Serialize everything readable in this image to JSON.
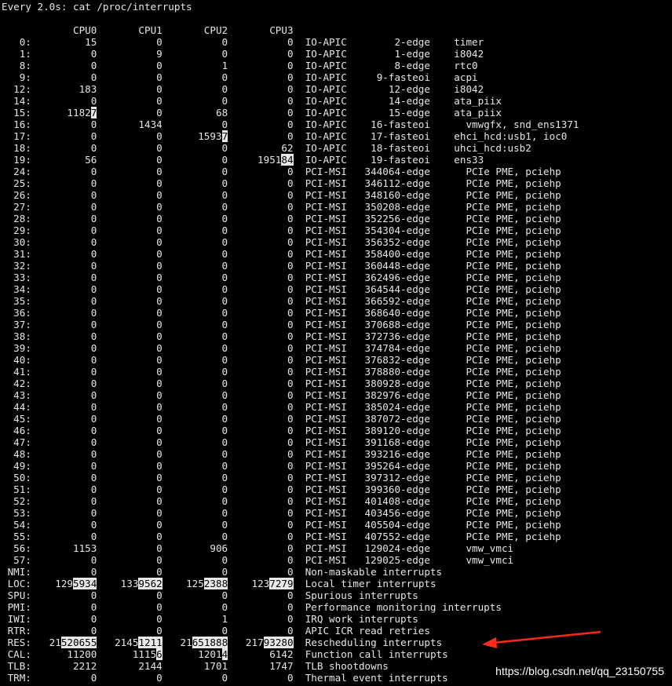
{
  "terminal": {
    "header": "Every 2.0s: cat /proc/interrupts",
    "cpu_header": [
      "CPU0",
      "CPU1",
      "CPU2",
      "CPU3"
    ],
    "rows": [
      {
        "irq": "0:",
        "c": [
          "15",
          "0",
          "0",
          "0"
        ],
        "chip": "IO-APIC",
        "hw": "2-edge",
        "dev": "timer"
      },
      {
        "irq": "1:",
        "c": [
          "0",
          "9",
          "0",
          "0"
        ],
        "chip": "IO-APIC",
        "hw": "1-edge",
        "dev": "i8042"
      },
      {
        "irq": "8:",
        "c": [
          "0",
          "0",
          "1",
          "0"
        ],
        "chip": "IO-APIC",
        "hw": "8-edge",
        "dev": "rtc0"
      },
      {
        "irq": "9:",
        "c": [
          "0",
          "0",
          "0",
          "0"
        ],
        "chip": "IO-APIC",
        "hw": "9-fasteoi",
        "dev": "acpi"
      },
      {
        "irq": "12:",
        "c": [
          "183",
          "0",
          "0",
          "0"
        ],
        "chip": "IO-APIC",
        "hw": "12-edge",
        "dev": "i8042"
      },
      {
        "irq": "14:",
        "c": [
          "0",
          "0",
          "0",
          "0"
        ],
        "chip": "IO-APIC",
        "hw": "14-edge",
        "dev": "ata_piix"
      },
      {
        "irq": "15:",
        "c": [
          "11827",
          "0",
          "68",
          "0"
        ],
        "chip": "IO-APIC",
        "hw": "15-edge",
        "dev": "ata_piix",
        "hl": [
          [
            0,
            1
          ]
        ]
      },
      {
        "irq": "16:",
        "c": [
          "0",
          "1434",
          "0",
          "0"
        ],
        "chip": "IO-APIC",
        "hw": "16-fasteoi",
        "dev": "vmwgfx, snd_ens1371"
      },
      {
        "irq": "17:",
        "c": [
          "0",
          "0",
          "15937",
          "0"
        ],
        "chip": "IO-APIC",
        "hw": "17-fasteoi",
        "dev": "ehci_hcd:usb1, ioc0",
        "hl": [
          [
            2,
            1
          ]
        ]
      },
      {
        "irq": "18:",
        "c": [
          "0",
          "0",
          "0",
          "62"
        ],
        "chip": "IO-APIC",
        "hw": "18-fasteoi",
        "dev": "uhci_hcd:usb2"
      },
      {
        "irq": "19:",
        "c": [
          "56",
          "0",
          "0",
          "195184"
        ],
        "chip": "IO-APIC",
        "hw": "19-fasteoi",
        "dev": "ens33",
        "hl": [
          [
            3,
            2
          ]
        ]
      },
      {
        "irq": "24:",
        "c": [
          "0",
          "0",
          "0",
          "0"
        ],
        "chip": "PCI-MSI",
        "hw": "344064-edge",
        "dev": "PCIe PME, pciehp"
      },
      {
        "irq": "25:",
        "c": [
          "0",
          "0",
          "0",
          "0"
        ],
        "chip": "PCI-MSI",
        "hw": "346112-edge",
        "dev": "PCIe PME, pciehp"
      },
      {
        "irq": "26:",
        "c": [
          "0",
          "0",
          "0",
          "0"
        ],
        "chip": "PCI-MSI",
        "hw": "348160-edge",
        "dev": "PCIe PME, pciehp"
      },
      {
        "irq": "27:",
        "c": [
          "0",
          "0",
          "0",
          "0"
        ],
        "chip": "PCI-MSI",
        "hw": "350208-edge",
        "dev": "PCIe PME, pciehp"
      },
      {
        "irq": "28:",
        "c": [
          "0",
          "0",
          "0",
          "0"
        ],
        "chip": "PCI-MSI",
        "hw": "352256-edge",
        "dev": "PCIe PME, pciehp"
      },
      {
        "irq": "29:",
        "c": [
          "0",
          "0",
          "0",
          "0"
        ],
        "chip": "PCI-MSI",
        "hw": "354304-edge",
        "dev": "PCIe PME, pciehp"
      },
      {
        "irq": "30:",
        "c": [
          "0",
          "0",
          "0",
          "0"
        ],
        "chip": "PCI-MSI",
        "hw": "356352-edge",
        "dev": "PCIe PME, pciehp"
      },
      {
        "irq": "31:",
        "c": [
          "0",
          "0",
          "0",
          "0"
        ],
        "chip": "PCI-MSI",
        "hw": "358400-edge",
        "dev": "PCIe PME, pciehp"
      },
      {
        "irq": "32:",
        "c": [
          "0",
          "0",
          "0",
          "0"
        ],
        "chip": "PCI-MSI",
        "hw": "360448-edge",
        "dev": "PCIe PME, pciehp"
      },
      {
        "irq": "33:",
        "c": [
          "0",
          "0",
          "0",
          "0"
        ],
        "chip": "PCI-MSI",
        "hw": "362496-edge",
        "dev": "PCIe PME, pciehp"
      },
      {
        "irq": "34:",
        "c": [
          "0",
          "0",
          "0",
          "0"
        ],
        "chip": "PCI-MSI",
        "hw": "364544-edge",
        "dev": "PCIe PME, pciehp"
      },
      {
        "irq": "35:",
        "c": [
          "0",
          "0",
          "0",
          "0"
        ],
        "chip": "PCI-MSI",
        "hw": "366592-edge",
        "dev": "PCIe PME, pciehp"
      },
      {
        "irq": "36:",
        "c": [
          "0",
          "0",
          "0",
          "0"
        ],
        "chip": "PCI-MSI",
        "hw": "368640-edge",
        "dev": "PCIe PME, pciehp"
      },
      {
        "irq": "37:",
        "c": [
          "0",
          "0",
          "0",
          "0"
        ],
        "chip": "PCI-MSI",
        "hw": "370688-edge",
        "dev": "PCIe PME, pciehp"
      },
      {
        "irq": "38:",
        "c": [
          "0",
          "0",
          "0",
          "0"
        ],
        "chip": "PCI-MSI",
        "hw": "372736-edge",
        "dev": "PCIe PME, pciehp"
      },
      {
        "irq": "39:",
        "c": [
          "0",
          "0",
          "0",
          "0"
        ],
        "chip": "PCI-MSI",
        "hw": "374784-edge",
        "dev": "PCIe PME, pciehp"
      },
      {
        "irq": "40:",
        "c": [
          "0",
          "0",
          "0",
          "0"
        ],
        "chip": "PCI-MSI",
        "hw": "376832-edge",
        "dev": "PCIe PME, pciehp"
      },
      {
        "irq": "41:",
        "c": [
          "0",
          "0",
          "0",
          "0"
        ],
        "chip": "PCI-MSI",
        "hw": "378880-edge",
        "dev": "PCIe PME, pciehp"
      },
      {
        "irq": "42:",
        "c": [
          "0",
          "0",
          "0",
          "0"
        ],
        "chip": "PCI-MSI",
        "hw": "380928-edge",
        "dev": "PCIe PME, pciehp"
      },
      {
        "irq": "43:",
        "c": [
          "0",
          "0",
          "0",
          "0"
        ],
        "chip": "PCI-MSI",
        "hw": "382976-edge",
        "dev": "PCIe PME, pciehp"
      },
      {
        "irq": "44:",
        "c": [
          "0",
          "0",
          "0",
          "0"
        ],
        "chip": "PCI-MSI",
        "hw": "385024-edge",
        "dev": "PCIe PME, pciehp"
      },
      {
        "irq": "45:",
        "c": [
          "0",
          "0",
          "0",
          "0"
        ],
        "chip": "PCI-MSI",
        "hw": "387072-edge",
        "dev": "PCIe PME, pciehp"
      },
      {
        "irq": "46:",
        "c": [
          "0",
          "0",
          "0",
          "0"
        ],
        "chip": "PCI-MSI",
        "hw": "389120-edge",
        "dev": "PCIe PME, pciehp"
      },
      {
        "irq": "47:",
        "c": [
          "0",
          "0",
          "0",
          "0"
        ],
        "chip": "PCI-MSI",
        "hw": "391168-edge",
        "dev": "PCIe PME, pciehp"
      },
      {
        "irq": "48:",
        "c": [
          "0",
          "0",
          "0",
          "0"
        ],
        "chip": "PCI-MSI",
        "hw": "393216-edge",
        "dev": "PCIe PME, pciehp"
      },
      {
        "irq": "49:",
        "c": [
          "0",
          "0",
          "0",
          "0"
        ],
        "chip": "PCI-MSI",
        "hw": "395264-edge",
        "dev": "PCIe PME, pciehp"
      },
      {
        "irq": "50:",
        "c": [
          "0",
          "0",
          "0",
          "0"
        ],
        "chip": "PCI-MSI",
        "hw": "397312-edge",
        "dev": "PCIe PME, pciehp"
      },
      {
        "irq": "51:",
        "c": [
          "0",
          "0",
          "0",
          "0"
        ],
        "chip": "PCI-MSI",
        "hw": "399360-edge",
        "dev": "PCIe PME, pciehp"
      },
      {
        "irq": "52:",
        "c": [
          "0",
          "0",
          "0",
          "0"
        ],
        "chip": "PCI-MSI",
        "hw": "401408-edge",
        "dev": "PCIe PME, pciehp"
      },
      {
        "irq": "53:",
        "c": [
          "0",
          "0",
          "0",
          "0"
        ],
        "chip": "PCI-MSI",
        "hw": "403456-edge",
        "dev": "PCIe PME, pciehp"
      },
      {
        "irq": "54:",
        "c": [
          "0",
          "0",
          "0",
          "0"
        ],
        "chip": "PCI-MSI",
        "hw": "405504-edge",
        "dev": "PCIe PME, pciehp"
      },
      {
        "irq": "55:",
        "c": [
          "0",
          "0",
          "0",
          "0"
        ],
        "chip": "PCI-MSI",
        "hw": "407552-edge",
        "dev": "PCIe PME, pciehp"
      },
      {
        "irq": "56:",
        "c": [
          "1153",
          "0",
          "906",
          "0"
        ],
        "chip": "PCI-MSI",
        "hw": "129024-edge",
        "dev": "vmw_vmci"
      },
      {
        "irq": "57:",
        "c": [
          "0",
          "0",
          "0",
          "0"
        ],
        "chip": "PCI-MSI",
        "hw": "129025-edge",
        "dev": "vmw_vmci"
      },
      {
        "irq": "NMI:",
        "c": [
          "0",
          "0",
          "0",
          "0"
        ],
        "desc": "Non-maskable interrupts"
      },
      {
        "irq": "LOC:",
        "c": [
          "1295934",
          "1339562",
          "1252388",
          "1237279"
        ],
        "desc": "Local timer interrupts",
        "hl": [
          [
            0,
            4
          ],
          [
            1,
            4
          ],
          [
            2,
            4
          ],
          [
            3,
            4
          ]
        ]
      },
      {
        "irq": "SPU:",
        "c": [
          "0",
          "0",
          "0",
          "0"
        ],
        "desc": "Spurious interrupts"
      },
      {
        "irq": "PMI:",
        "c": [
          "0",
          "0",
          "0",
          "0"
        ],
        "desc": "Performance monitoring interrupts"
      },
      {
        "irq": "IWI:",
        "c": [
          "0",
          "0",
          "1",
          "0"
        ],
        "desc": "IRQ work interrupts"
      },
      {
        "irq": "RTR:",
        "c": [
          "0",
          "0",
          "0",
          "0"
        ],
        "desc": "APIC ICR read retries"
      },
      {
        "irq": "RES:",
        "c": [
          "21520655",
          "21451211",
          "21651888",
          "21793280"
        ],
        "desc": "Rescheduling interrupts",
        "hl": [
          [
            0,
            6
          ],
          [
            1,
            4
          ],
          [
            2,
            6
          ],
          [
            3,
            5
          ]
        ]
      },
      {
        "irq": "CAL:",
        "c": [
          "11200",
          "11156",
          "12014",
          "6142"
        ],
        "desc": "Function call interrupts",
        "hl": [
          [
            1,
            1
          ],
          [
            2,
            1
          ]
        ]
      },
      {
        "irq": "TLB:",
        "c": [
          "2212",
          "2144",
          "1701",
          "1747"
        ],
        "desc": "TLB shootdowns"
      },
      {
        "irq": "TRM:",
        "c": [
          "0",
          "0",
          "0",
          "0"
        ],
        "desc": "Thermal event interrupts"
      }
    ]
  },
  "watermark": "https://blog.csdn.net/qq_23150755",
  "colors": {
    "background": "#000000",
    "text": "#e6e6e6",
    "highlight_bg": "#e8e8e8",
    "highlight_fg": "#000000",
    "arrow": "#ff2a1a"
  },
  "icons": [
    "red-arrow-annotation"
  ]
}
